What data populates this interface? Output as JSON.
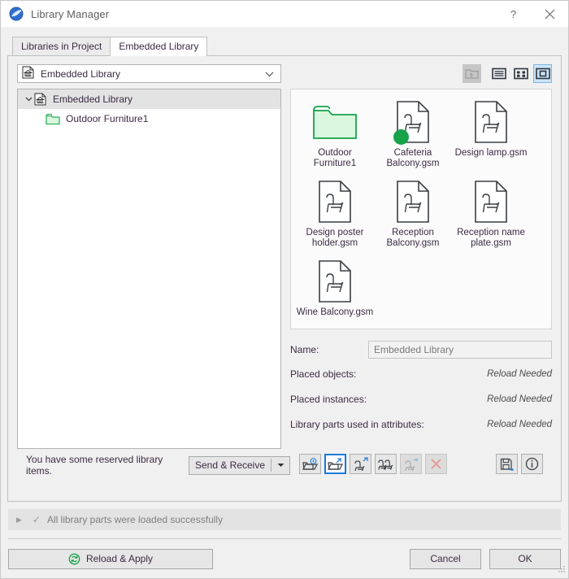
{
  "window": {
    "title": "Library Manager",
    "icon": "app-globe-icon",
    "help_label": "?",
    "close_label": "✕"
  },
  "tabs": [
    {
      "label": "Libraries in Project",
      "active": false
    },
    {
      "label": "Embedded Library",
      "active": true
    }
  ],
  "left": {
    "combo": {
      "value": "Embedded Library",
      "icon": "library-bank-icon",
      "chevron": "chevron-down-icon"
    },
    "tree": [
      {
        "label": "Embedded Library",
        "icon": "library-bank-icon",
        "level": 0,
        "selected": true,
        "expanded": true
      },
      {
        "label": "Outdoor Furniture1",
        "icon": "folder-icon",
        "level": 1,
        "selected": false
      }
    ],
    "reserved_text": "You have some reserved library items.",
    "send_receive_label": "Send & Receive",
    "send_receive_arrow": "caret-down-icon"
  },
  "right": {
    "view_buttons": [
      {
        "name": "up-one-level-button",
        "icon": "folder-up-icon",
        "state": "disabled"
      },
      {
        "name": "list-view-button",
        "icon": "list-view-icon",
        "state": "normal"
      },
      {
        "name": "details-view-button",
        "icon": "grid-view-icon",
        "state": "normal"
      },
      {
        "name": "large-icon-view-button",
        "icon": "large-icon-view-icon",
        "state": "selected"
      }
    ],
    "items": [
      {
        "label": "Outdoor Furniture1",
        "icon": "folder-icon",
        "badge": null
      },
      {
        "label": "Cafeteria Balcony.gsm",
        "icon": "gsm-part-icon",
        "badge": "green-dot"
      },
      {
        "label": "Design lamp.gsm",
        "icon": "gsm-part-icon",
        "badge": null
      },
      {
        "label": "Design poster holder.gsm",
        "icon": "gsm-part-icon",
        "badge": null
      },
      {
        "label": "Reception Balcony.gsm",
        "icon": "gsm-part-icon",
        "badge": null
      },
      {
        "label": "Reception name plate.gsm",
        "icon": "gsm-part-icon",
        "badge": null
      },
      {
        "label": "Wine Balcony.gsm",
        "icon": "gsm-part-icon",
        "badge": null
      }
    ],
    "details": {
      "name_label": "Name:",
      "name_value": "Embedded Library",
      "rows": [
        {
          "label": "Placed objects:",
          "value": "Reload Needed"
        },
        {
          "label": "Placed instances:",
          "value": "Reload Needed"
        },
        {
          "label": "Library parts used in attributes:",
          "value": "Reload Needed"
        }
      ]
    },
    "toolbar": [
      {
        "name": "add-library-button",
        "icon": "folder-plus-icon",
        "state": "normal"
      },
      {
        "name": "open-library-button",
        "icon": "folder-arrow-icon",
        "state": "selected"
      },
      {
        "name": "duplicate-part-button",
        "icon": "chair-arrow-icon",
        "state": "normal"
      },
      {
        "name": "multiple-parts-button",
        "icon": "chairs-icon",
        "state": "normal"
      },
      {
        "name": "move-part-button",
        "icon": "chair-move-icon",
        "state": "disabled"
      },
      {
        "name": "delete-part-button",
        "icon": "close-x-icon",
        "state": "disabled"
      },
      {
        "name": "save-as-button",
        "icon": "save-arrow-icon",
        "state": "normal"
      },
      {
        "name": "info-button",
        "icon": "info-circle-icon",
        "state": "normal"
      }
    ]
  },
  "status": {
    "expand_icon": "triangle-right-icon",
    "check_icon": "check-icon",
    "message": "All library parts were loaded successfully"
  },
  "footer": {
    "reload_label": "Reload & Apply",
    "reload_icon": "refresh-circle-icon",
    "cancel_label": "Cancel",
    "ok_label": "OK"
  },
  "colors": {
    "accent": "#1a7ad9",
    "green": "#17a34a",
    "text": "#3b2b44",
    "panel": "#f0f0f0"
  }
}
